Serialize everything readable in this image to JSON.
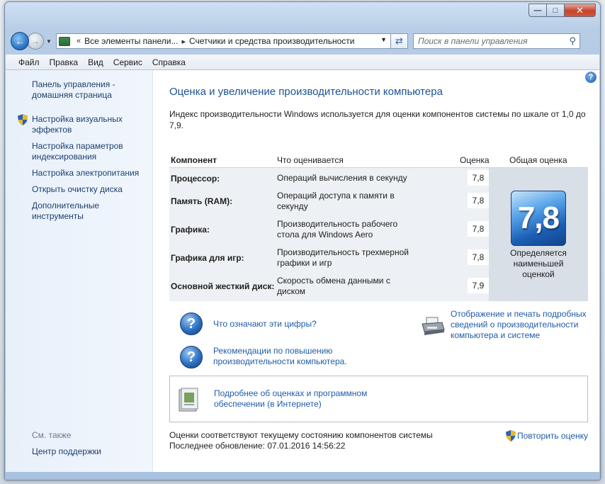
{
  "address": {
    "crumbs": [
      "Все элементы панели...",
      "Счетчики и средства производительности"
    ]
  },
  "search": {
    "placeholder": "Поиск в панели управления"
  },
  "menu": [
    "Файл",
    "Правка",
    "Вид",
    "Сервис",
    "Справка"
  ],
  "sidebar": {
    "home": [
      "Панель управления -",
      "домашняя страница"
    ],
    "items": [
      [
        "Настройка визуальных",
        "эффектов"
      ],
      [
        "Настройка параметров",
        "индексирования"
      ],
      [
        "Настройка электропитания"
      ],
      [
        "Открыть очистку диска"
      ],
      [
        "Дополнительные",
        "инструменты"
      ]
    ],
    "see_also": "См. также",
    "support": "Центр поддержки"
  },
  "main": {
    "title": "Оценка и увеличение производительности компьютера",
    "intro": "Индекс производительности Windows используется для оценки компонентов системы по шкале от 1,0 до 7,9."
  },
  "table": {
    "headers": {
      "component": "Компонент",
      "rated": "Что оценивается",
      "score": "Оценка",
      "overall": "Общая оценка"
    },
    "rows": [
      {
        "label": "Процессор:",
        "desc": [
          "Операций вычисления в секунду"
        ],
        "score": "7,8"
      },
      {
        "label": "Память (RAM):",
        "desc": [
          "Операций доступа к памяти в",
          "секунду"
        ],
        "score": "7,8"
      },
      {
        "label": "Графика:",
        "desc": [
          "Производительность рабочего",
          "стола для Windows Aero"
        ],
        "score": "7,8"
      },
      {
        "label": "Графика для игр:",
        "desc": [
          "Производительность трехмерной",
          "графики и игр"
        ],
        "score": "7,8"
      },
      {
        "label": "Основной жесткий диск:",
        "desc": [
          "Скорость обмена данными с",
          "диском"
        ],
        "score": "7,9"
      }
    ],
    "overall": {
      "score": "7,8",
      "note": [
        "Определяется",
        "наименьшей",
        "оценкой"
      ]
    }
  },
  "links": {
    "what_numbers": "Что означают эти цифры?",
    "tips": [
      "Рекомендации по повышению",
      "производительности компьютера."
    ],
    "print": [
      "Отображение и печать подробных",
      "сведений о производительности",
      "компьютера и системе"
    ],
    "online": [
      "Подробнее об оценках и программном",
      "обеспечении (в Интернете)"
    ]
  },
  "status": {
    "line1": "Оценки соответствуют текущему состоянию компонентов системы",
    "line2": "Последнее обновление: 07.01.2016 14:56:22",
    "rerun": "Повторить оценку"
  }
}
